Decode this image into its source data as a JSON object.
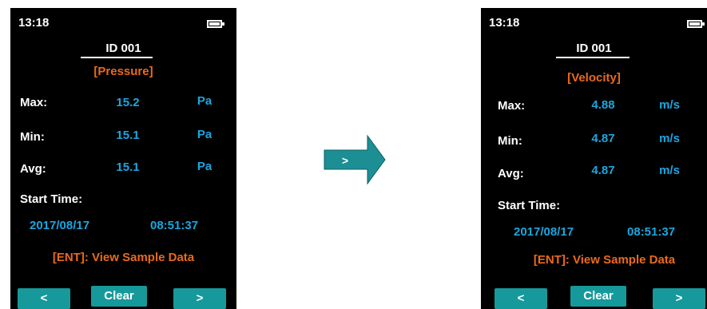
{
  "screens": [
    {
      "time": "13:18",
      "device_id": "ID  001",
      "mode": "[Pressure]",
      "rows": [
        {
          "label": "Max:",
          "value": "15.2",
          "unit": "Pa"
        },
        {
          "label": "Min:",
          "value": "15.1",
          "unit": "Pa"
        },
        {
          "label": "Avg:",
          "value": "15.1",
          "unit": "Pa"
        }
      ],
      "start_time_label": "Start Time:",
      "start_date": "2017/08/17",
      "start_clock": "08:51:37",
      "hint": "[ENT]: View Sample Data",
      "softkeys": {
        "prev": "<",
        "clear": "Clear",
        "next": ">"
      }
    },
    {
      "time": "13:18",
      "device_id": "ID  001",
      "mode": "[Velocity]",
      "rows": [
        {
          "label": "Max:",
          "value": "4.88",
          "unit": "m/s"
        },
        {
          "label": "Min:",
          "value": "4.87",
          "unit": "m/s"
        },
        {
          "label": "Avg:",
          "value": "4.87",
          "unit": "m/s"
        }
      ],
      "start_time_label": "Start Time:",
      "start_date": "2017/08/17",
      "start_clock": "08:51:37",
      "hint": "[ENT]: View Sample Data",
      "softkeys": {
        "prev": "<",
        "clear": "Clear",
        "next": ">"
      }
    }
  ],
  "center_arrow": {
    "label": ">"
  },
  "colors": {
    "screen_bg": "#000000",
    "value_blue": "#1aa7e0",
    "accent_orange": "#ea6a1a",
    "softkey_teal": "#16999b",
    "arrow_teal": "#1b8f94"
  }
}
